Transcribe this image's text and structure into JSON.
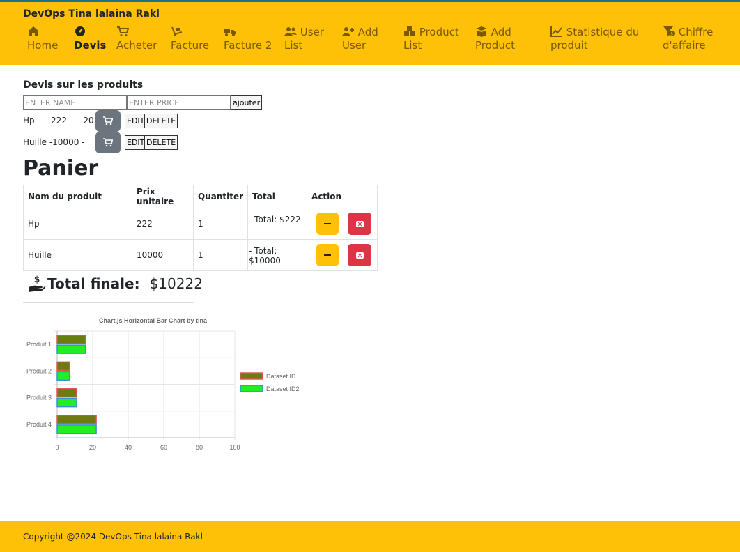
{
  "brand": "DevOps Tina lalaina Rakl",
  "nav": [
    {
      "icon": "home-icon",
      "line1": "Home",
      "line2": ""
    },
    {
      "icon": "gauge-icon",
      "line1": "Devis",
      "line2": ""
    },
    {
      "icon": "cart-icon",
      "line1": "Acheter",
      "line2": ""
    },
    {
      "icon": "hand-dolly-icon",
      "line1": "Facture",
      "line2": ""
    },
    {
      "icon": "truck-icon",
      "line1": "Facture 2",
      "line2": ""
    },
    {
      "icon": "users-icon",
      "line1": "User",
      "line2": "List"
    },
    {
      "icon": "user-plus-icon",
      "line1": "Add",
      "line2": "User"
    },
    {
      "icon": "boxes-icon",
      "line1": "Product",
      "line2": "List"
    },
    {
      "icon": "box-open-icon",
      "line1": "Add",
      "line2": "Product"
    },
    {
      "icon": "line-chart-icon",
      "line1": "Statistique du",
      "line2": "produit"
    },
    {
      "icon": "filter-dollar-icon",
      "line1": "Chiffre",
      "line2": "d'affaire"
    }
  ],
  "devis": {
    "title": "Devis sur les produits",
    "name_placeholder": "ENTER NAME",
    "price_placeholder": "ENTER PRICE",
    "add_label": "ajouter",
    "products": [
      {
        "text": "Hp -    222 -    20",
        "edit": "EDIT",
        "delete": "DELETE"
      },
      {
        "text": "Huille -10000 -",
        "edit": "EDIT",
        "delete": "DELETE"
      }
    ]
  },
  "panier": {
    "title": "Panier",
    "headers": [
      "Nom du produit",
      "Prix unitaire",
      "Quantiter",
      "Total",
      "Action"
    ],
    "rows": [
      {
        "name": "Hp",
        "price": "222",
        "qty": "1",
        "total": "- Total: $222"
      },
      {
        "name": "Huille",
        "price": "10000",
        "qty": "1",
        "total": "- Total: $10000"
      }
    ],
    "total_label": "Total finale:",
    "total_value": "$10222"
  },
  "chart_data": {
    "type": "bar",
    "orientation": "horizontal",
    "title": "Chart.js Horizontal Bar Chart by tina",
    "categories": [
      "Produit 1",
      "Produit 2",
      "Produit 3",
      "Produit 4"
    ],
    "series": [
      {
        "name": "Dataset ID",
        "values": [
          16,
          7,
          11,
          22
        ],
        "color": "#6b7c10",
        "border": "#e05555"
      },
      {
        "name": "Dataset ID2",
        "values": [
          16,
          7,
          11,
          22
        ],
        "color": "#22ee22",
        "border": "#3a8fd8"
      }
    ],
    "xlim": [
      0,
      100
    ],
    "xticks": [
      "0",
      "20",
      "40",
      "60",
      "80",
      "100"
    ],
    "grid": true,
    "legend": "right"
  },
  "footer": "Copyright @2024 DevOps Tina lalaina Rakl",
  "colors": {
    "accent": "#ffc107",
    "danger": "#dc3545",
    "secondary": "#6c757d"
  }
}
